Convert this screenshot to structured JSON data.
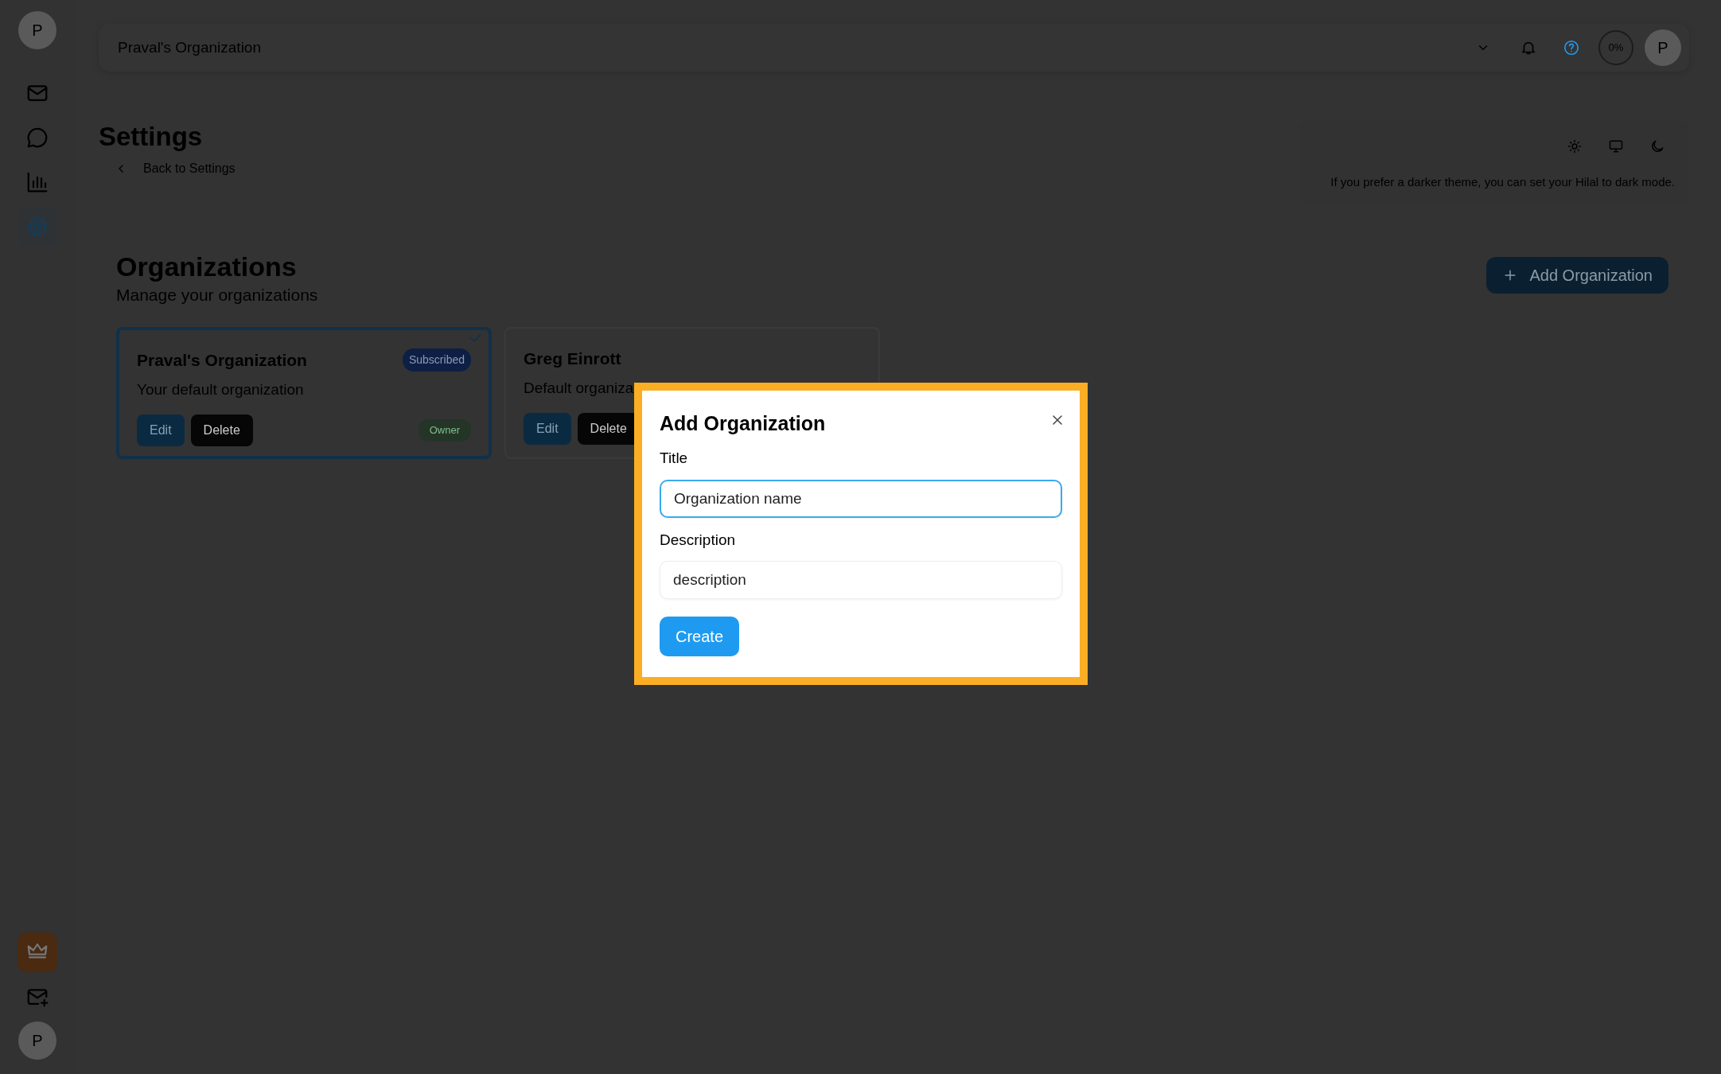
{
  "sidebar": {
    "top_avatar": "P",
    "items": [
      {
        "kind": "mail",
        "selected": false
      },
      {
        "kind": "chat",
        "selected": false
      },
      {
        "kind": "chart",
        "selected": false
      },
      {
        "kind": "settings",
        "selected": true
      }
    ],
    "bottom_items": [
      {
        "kind": "crown"
      },
      {
        "kind": "mail-plus"
      }
    ],
    "bottom_avatar": "P"
  },
  "top_bar": {
    "organization_select": "Praval's Organization",
    "progress": "0%",
    "avatar": "P"
  },
  "header": {
    "title": "Settings",
    "back_link": "Back to Settings",
    "theme_modes": [
      {
        "kind": "light"
      },
      {
        "kind": "system"
      },
      {
        "kind": "dark"
      }
    ],
    "theme_hint": "If you prefer a darker theme, you can set your Hilal to dark mode."
  },
  "organizations": {
    "title": "Organizations",
    "subtitle": "Manage your organizations",
    "add_button": "Add Organization",
    "cards": [
      {
        "name": "Praval's Organization",
        "description": "Your default organization",
        "selected": true,
        "badge": "Subscribed",
        "role": "Owner",
        "buttons": [
          "Edit",
          "Delete"
        ]
      },
      {
        "name": "Greg Einrott",
        "description": "Default organiza",
        "selected": false,
        "buttons": [
          "Edit",
          "Delete"
        ]
      }
    ]
  },
  "modal": {
    "title": "Add Organization",
    "fields": [
      {
        "label": "Title",
        "placeholder": "Organization name",
        "focused": true
      },
      {
        "label": "Description",
        "placeholder": "description",
        "focused": false
      }
    ],
    "submit": "Create"
  }
}
